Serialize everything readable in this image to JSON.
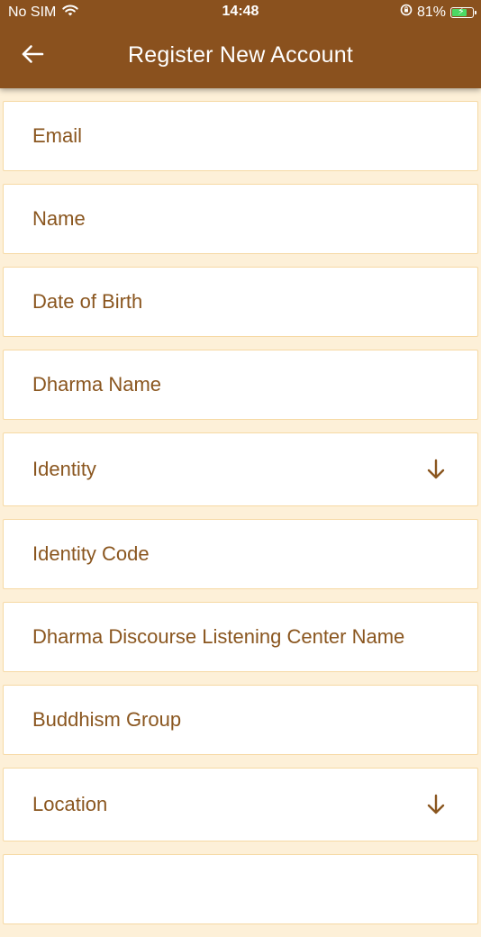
{
  "status_bar": {
    "carrier": "No SIM",
    "time": "14:48",
    "battery_percent": "81%",
    "battery_level": 0.81,
    "icons": [
      "wifi-icon",
      "orientation-lock-icon",
      "battery-charging-icon"
    ]
  },
  "header": {
    "title": "Register New Account",
    "back_icon": "arrow-left-icon"
  },
  "colors": {
    "app_bar": "#8a511e",
    "background": "#fdf0d8",
    "field_border": "#f6d9a4",
    "field_text": "#8a561f"
  },
  "form": {
    "fields": [
      {
        "placeholder": "Email",
        "type": "text"
      },
      {
        "placeholder": "Name",
        "type": "text"
      },
      {
        "placeholder": "Date of Birth",
        "type": "text"
      },
      {
        "placeholder": "Dharma Name",
        "type": "text"
      },
      {
        "placeholder": "Identity",
        "type": "dropdown",
        "icon": "arrow-down-icon"
      },
      {
        "placeholder": "Identity Code",
        "type": "text"
      },
      {
        "placeholder": "Dharma Discourse Listening Center Name",
        "type": "text"
      },
      {
        "placeholder": "Buddhism Group",
        "type": "text"
      },
      {
        "placeholder": "Location",
        "type": "dropdown",
        "icon": "arrow-down-icon"
      }
    ]
  }
}
